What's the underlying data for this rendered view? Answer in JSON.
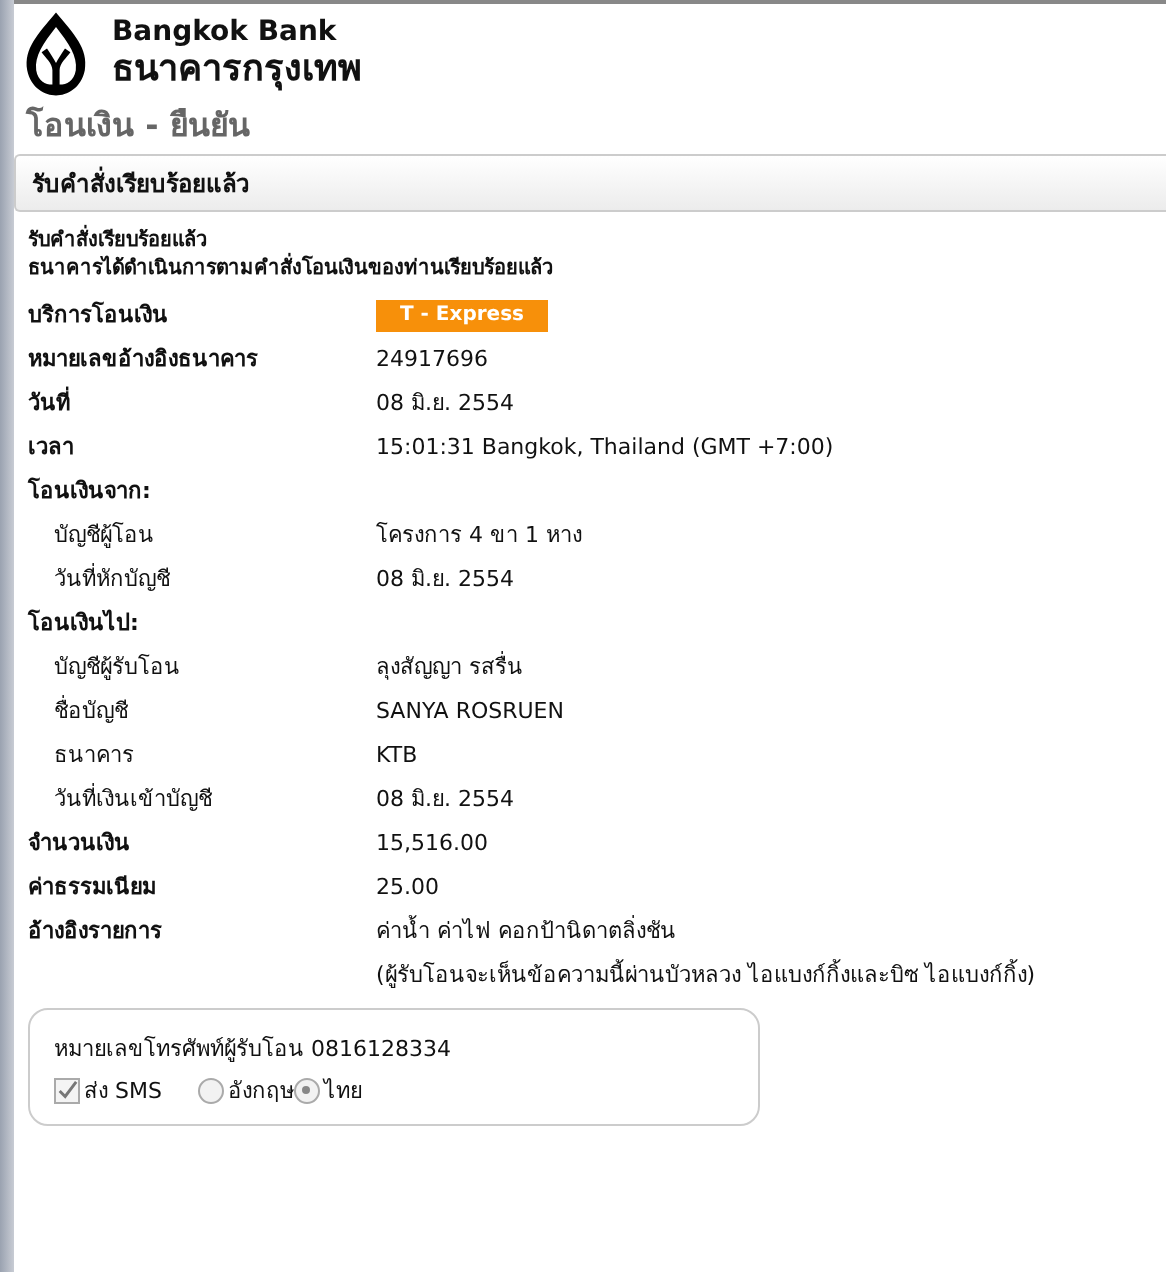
{
  "logo": {
    "english": "Bangkok Bank",
    "thai": "ธนาคารกรุงเทพ"
  },
  "page_title": "โอนเงิน - ยืนยัน",
  "section_header": "รับคำสั่งเรียบร้อยแล้ว",
  "messages": [
    "รับคำสั่งเรียบร้อยแล้ว",
    "ธนาคารได้ดำเนินการตามคำสั่งโอนเงินของท่านเรียบร้อยแล้ว"
  ],
  "details": [
    {
      "label": "บริการโอนเงิน",
      "kind": "badge",
      "value": "T - Express"
    },
    {
      "label": "หมายเลขอ้างอิงธนาคาร",
      "kind": "text",
      "value": "24917696"
    },
    {
      "label": "วันที่",
      "kind": "text",
      "value": "08 มิ.ย. 2554"
    },
    {
      "label": "เวลา",
      "kind": "text",
      "value": "15:01:31 Bangkok, Thailand (GMT +7:00)"
    },
    {
      "label": "โอนเงินจาก:",
      "kind": "group",
      "children": [
        {
          "label": "บัญชีผู้โอน",
          "kind": "text",
          "value": "โครงการ 4 ขา 1 หาง"
        },
        {
          "label": "วันที่หักบัญชี",
          "kind": "text",
          "value": "08 มิ.ย. 2554"
        }
      ]
    },
    {
      "label": "โอนเงินไป:",
      "kind": "group",
      "children": [
        {
          "label": "บัญชีผู้รับโอน",
          "kind": "text",
          "value": "ลุงสัญญา รสรื่น"
        },
        {
          "label": "ชื่อบัญชี",
          "kind": "text",
          "value": "SANYA ROSRUEN"
        },
        {
          "label": "ธนาคาร",
          "kind": "text",
          "value": "KTB"
        },
        {
          "label": "วันที่เงินเข้าบัญชี",
          "kind": "text",
          "value": "08 มิ.ย. 2554"
        }
      ]
    },
    {
      "label": "จำนวนเงิน",
      "kind": "text",
      "value": "15,516.00"
    },
    {
      "label": "ค่าธรรมเนียม",
      "kind": "text",
      "value": "25.00"
    },
    {
      "label": "อ้างอิงรายการ",
      "kind": "lines",
      "lines": [
        "ค่าน้ำ ค่าไฟ คอกป้านิดาตลิ่งชัน",
        "(ผู้รับโอนจะเห็นข้อความนี้ผ่านบัวหลวง ไอแบงก์กิ้งและบิซ ไอแบงก์กิ้ง)"
      ]
    }
  ],
  "sms": {
    "phone_text": "หมายเลขโทรศัพท์ผู้รับโอน 0816128334",
    "send_sms": {
      "label": "ส่ง SMS",
      "checked": true
    },
    "languages": [
      {
        "label": "อังกฤษ",
        "selected": false
      },
      {
        "label": "ไทย",
        "selected": true
      }
    ]
  }
}
